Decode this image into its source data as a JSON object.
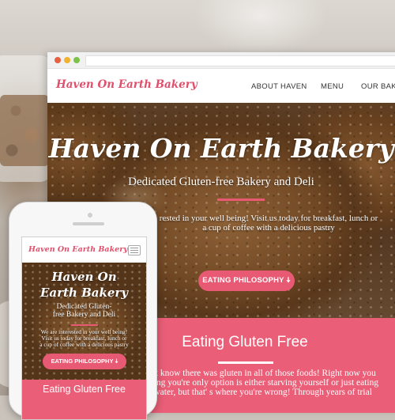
{
  "colors": {
    "accent": "#e85a74",
    "pink_section": "#ea5e77",
    "logo": "#e04f6b"
  },
  "desktop": {
    "logo": "Haven On Earth Bakery",
    "nav": [
      "ABOUT HAVEN",
      "MENU",
      "OUR BAKI"
    ],
    "hero": {
      "title": "Haven On Earth Bakery",
      "subtitle": "Dedicated Gluten-free Bakery and Deli",
      "body_line1": "rested in your well being! Visit us today for breakfast, lunch or",
      "body_line2": "a cup of coffee with a delicious pastry",
      "button": "EATING PHILOSOPHY",
      "button_icon": "arrow-down-icon"
    },
    "section": {
      "title": "Eating Gluten Free",
      "body_line1": "idn't know there was gluten in all of those foods! Right now you",
      "body_line2": "inking you're only option is either starving yourself or just eating",
      "body_line3": "nd water, but that' s where you're wrong! Through years of trial"
    }
  },
  "mobile": {
    "logo": "Haven On Earth Bakery",
    "menu_icon": "hamburger-menu-icon",
    "hero": {
      "title_line1": "Haven On",
      "title_line2": "Earth Bakery",
      "subtitle_line1": "Dedicated Gluten-",
      "subtitle_line2": "free Bakery and Deli",
      "body_line1": "We are interested in your well being!",
      "body_line2": "Visit us today for breakfast, lunch or",
      "body_line3": "a cup of coffee with a delicious pastry",
      "button": "EATING PHILOSOPHY",
      "button_icon": "arrow-down-icon"
    },
    "section": {
      "title": "Eating Gluten Free"
    }
  }
}
